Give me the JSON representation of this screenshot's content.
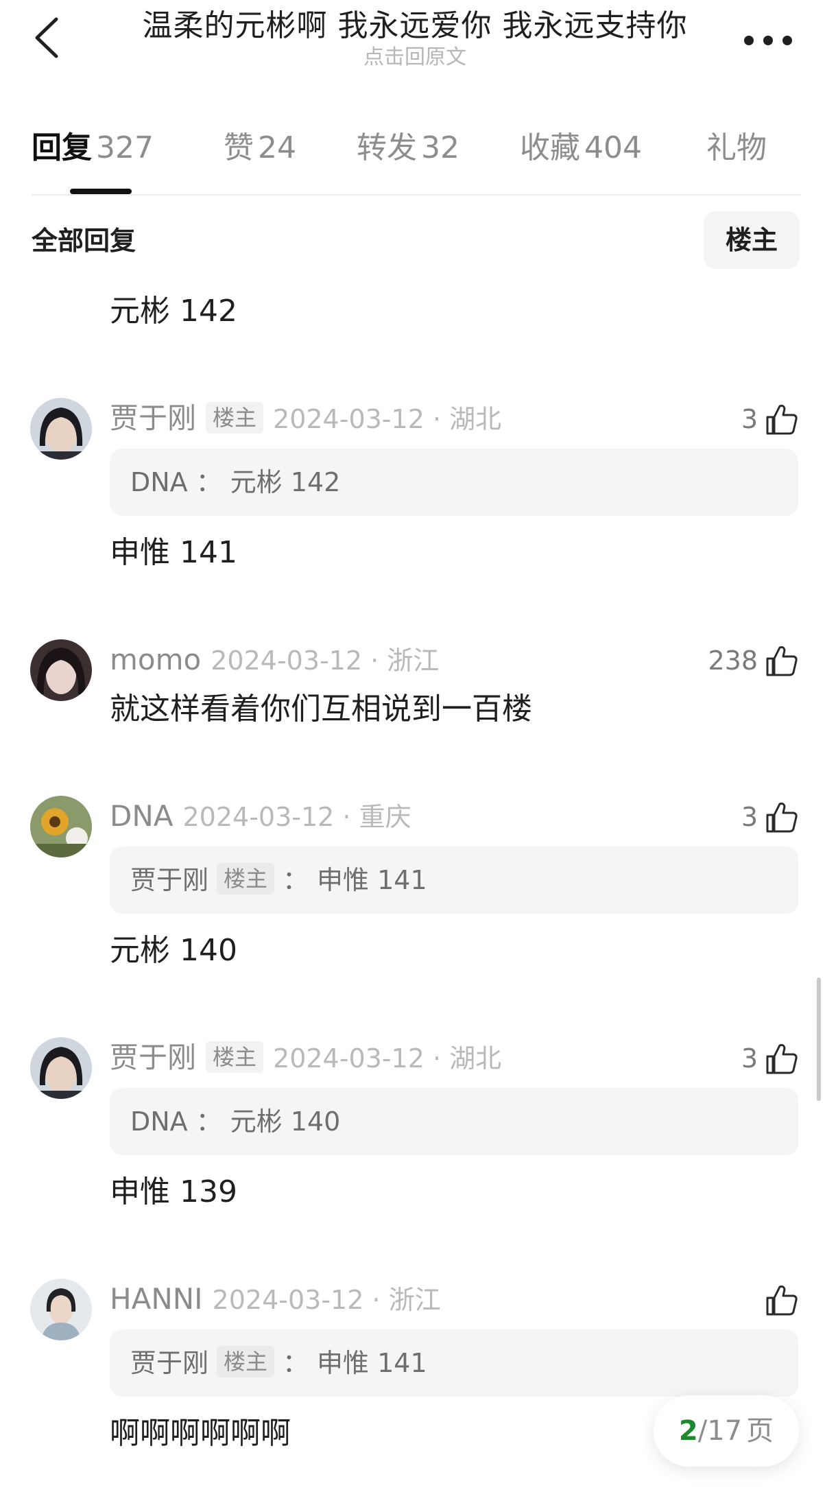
{
  "header": {
    "title": "温柔的元彬啊 我永远爱你 我永远支持你",
    "subtitle": "点击回原文"
  },
  "tabs": [
    {
      "label": "回复",
      "count": "327",
      "active": true
    },
    {
      "label": "赞",
      "count": "24",
      "active": false
    },
    {
      "label": "转发",
      "count": "32",
      "active": false
    },
    {
      "label": "收藏",
      "count": "404",
      "active": false
    },
    {
      "label": "礼物",
      "count": "",
      "active": false
    }
  ],
  "filter": {
    "all_label": "全部回复",
    "host_button": "楼主"
  },
  "top_partial_text": "元彬 142",
  "comments": [
    {
      "avatar": "avatar-icon",
      "username": "贾于刚",
      "badge": "楼主",
      "time_location": "2024-03-12 · 湖北",
      "likes": "3",
      "quote": {
        "name": "DNA",
        "badge": "",
        "sep": "：",
        "text": "元彬 142"
      },
      "text": "申惟 141"
    },
    {
      "avatar": "avatar-icon",
      "username": "momo",
      "badge": "",
      "time_location": "2024-03-12 · 浙江",
      "likes": "238",
      "quote": null,
      "text": "就这样看着你们互相说到一百楼"
    },
    {
      "avatar": "avatar-icon",
      "username": "DNA",
      "badge": "",
      "time_location": "2024-03-12 · 重庆",
      "likes": "3",
      "quote": {
        "name": "贾于刚",
        "badge": "楼主",
        "sep": "：",
        "text": "申惟 141"
      },
      "text": "元彬 140"
    },
    {
      "avatar": "avatar-icon",
      "username": "贾于刚",
      "badge": "楼主",
      "time_location": "2024-03-12 · 湖北",
      "likes": "3",
      "quote": {
        "name": "DNA",
        "badge": "",
        "sep": "：",
        "text": "元彬 140"
      },
      "text": "申惟 139"
    },
    {
      "avatar": "avatar-icon",
      "username": "HANNI",
      "badge": "",
      "time_location": "2024-03-12 · 浙江",
      "likes": "",
      "quote": {
        "name": "贾于刚",
        "badge": "楼主",
        "sep": "：",
        "text": "申惟 141"
      },
      "text": "啊啊啊啊啊啊"
    }
  ],
  "pagination": {
    "current": "2",
    "separator": "/",
    "total": "17",
    "unit": "页"
  },
  "colors": {
    "accent_green": "#1b8a2e",
    "text_primary": "#1f1f1f",
    "text_secondary": "#8b8b8b",
    "quote_bg": "#f5f5f5"
  }
}
